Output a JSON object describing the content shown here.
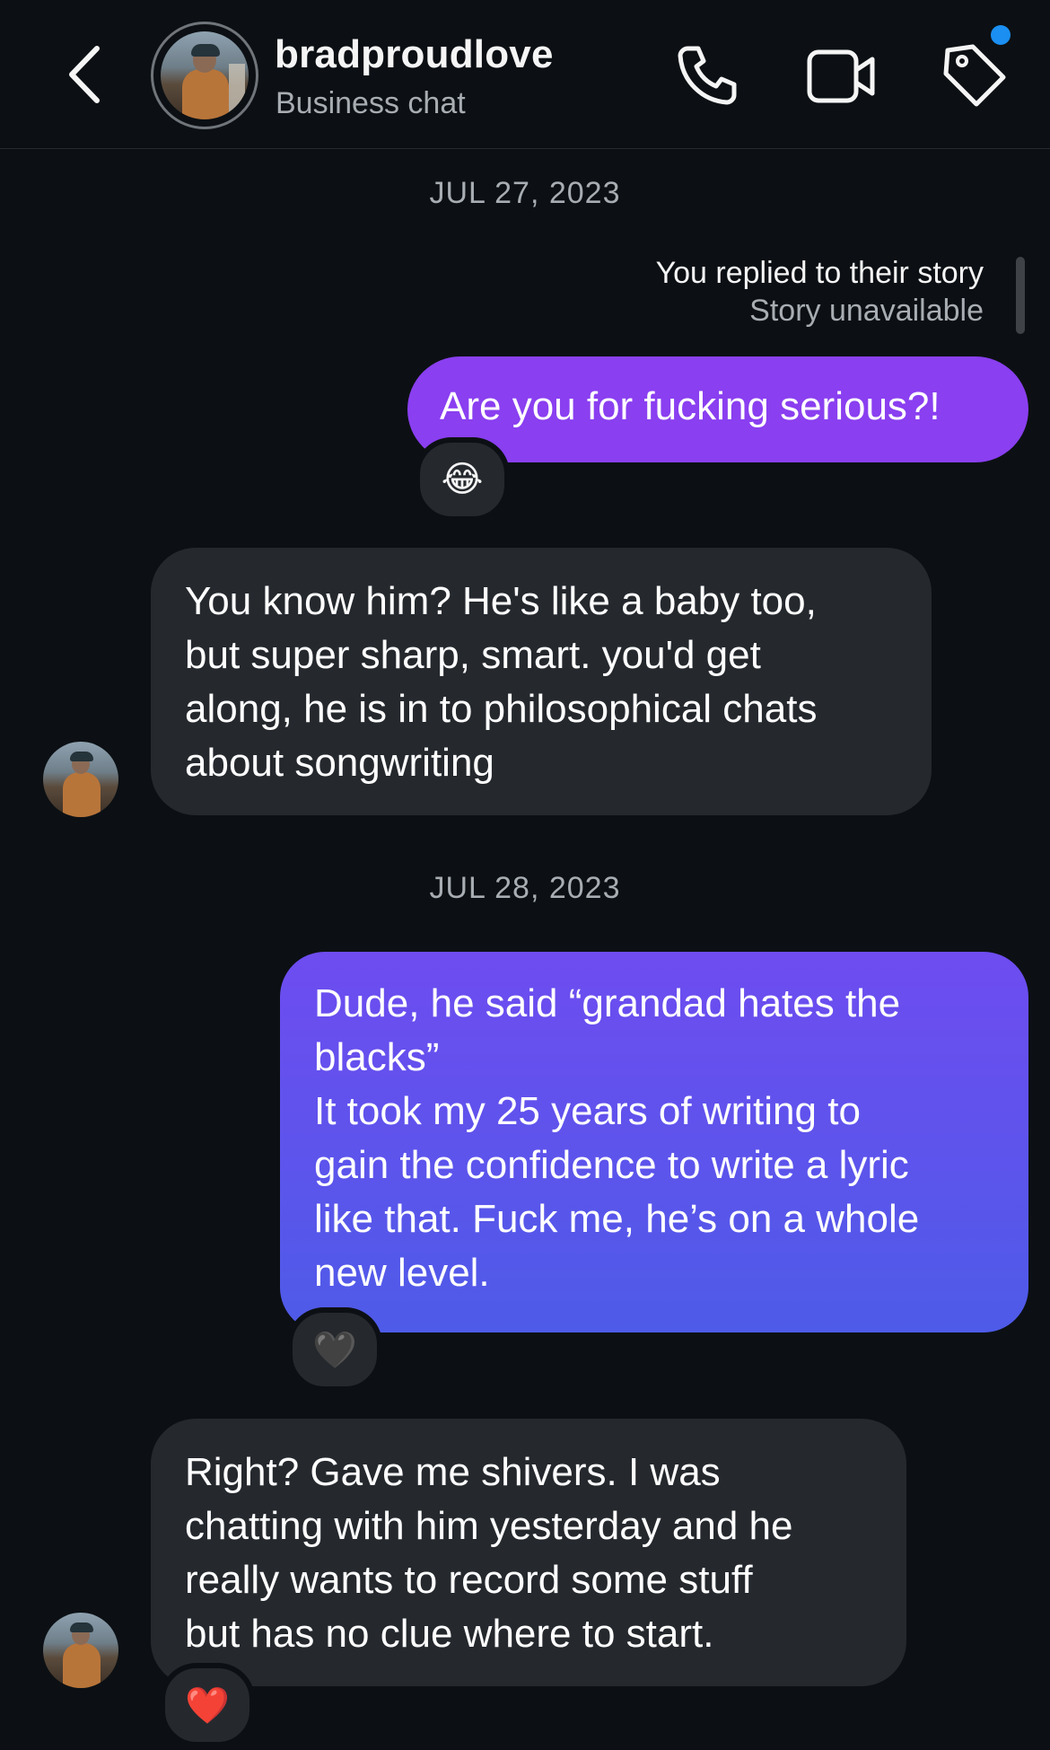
{
  "header": {
    "name": "bradproudlove",
    "subtitle": "Business chat",
    "back_icon": "chevron-left-icon",
    "call_icon": "phone-icon",
    "video_icon": "video-camera-icon",
    "label_icon": "tag-icon",
    "notification_dot_color": "#1b8ff2"
  },
  "dates": {
    "first": "JUL 27, 2023",
    "second": "JUL 28, 2023"
  },
  "story_reply": {
    "label": "You replied to their story",
    "status": "Story unavailable"
  },
  "messages": [
    {
      "from": "me",
      "text": "Are you for fucking serious?!",
      "reaction": "😂"
    },
    {
      "from": "them",
      "lines": [
        "You know him? He's like a baby too,",
        "but super sharp, smart. you'd get",
        "along, he is in to philosophical chats",
        "about songwriting"
      ]
    },
    {
      "from": "me",
      "lines": [
        "Dude, he said “grandad hates the",
        "blacks”",
        "It took my 25 years of writing to",
        "gain the confidence to write a lyric",
        "like that. Fuck me, he’s on a whole",
        "new level."
      ],
      "reaction": "🖤"
    },
    {
      "from": "them",
      "lines": [
        "Right? Gave me shivers. I was",
        "chatting with him yesterday and he",
        "really wants to record some stuff",
        "but has no clue where to start."
      ],
      "reaction": "❤️"
    }
  ],
  "colors": {
    "background": "#0c1014",
    "outgoing_purple": "#8a3ff0",
    "outgoing_gradient_top": "#6e4cf0",
    "outgoing_gradient_bottom": "#4e5be8",
    "incoming_bubble": "#25292e"
  }
}
